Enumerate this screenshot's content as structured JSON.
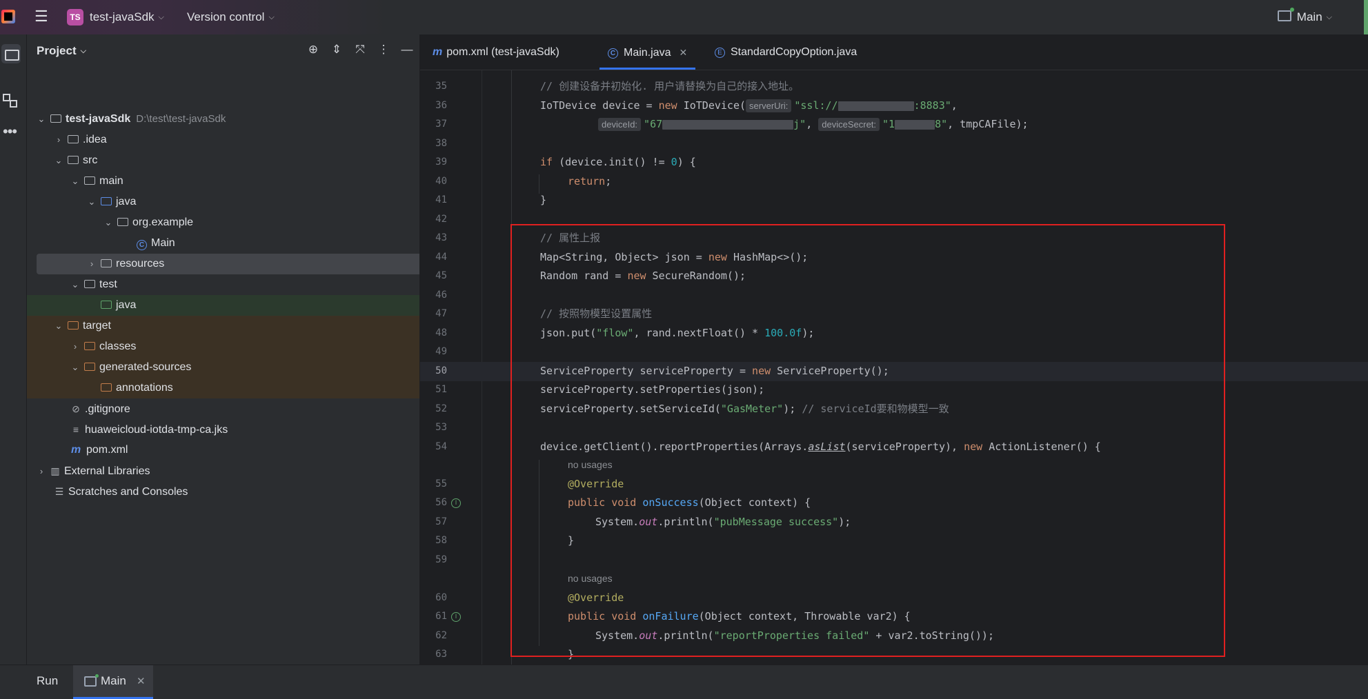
{
  "titlebar": {
    "project_chip": "TS",
    "project_name": "test-javaSdk",
    "vcs": "Version control",
    "run_config": "Main"
  },
  "project_panel": {
    "title": "Project",
    "tree": [
      {
        "label": "test-javaSdk",
        "hint": "D:\\test\\test-javaSdk"
      },
      {
        "label": ".idea"
      },
      {
        "label": "src"
      },
      {
        "label": "main"
      },
      {
        "label": "java"
      },
      {
        "label": "org.example"
      },
      {
        "label": "Main"
      },
      {
        "label": "resources"
      },
      {
        "label": "test"
      },
      {
        "label": "java"
      },
      {
        "label": "target"
      },
      {
        "label": "classes"
      },
      {
        "label": "generated-sources"
      },
      {
        "label": "annotations"
      },
      {
        "label": ".gitignore"
      },
      {
        "label": "huaweicloud-iotda-tmp-ca.jks"
      },
      {
        "label": "pom.xml"
      },
      {
        "label": "External Libraries"
      },
      {
        "label": "Scratches and Consoles"
      }
    ]
  },
  "editor": {
    "tabs": [
      {
        "label": "pom.xml (test-javaSdk)"
      },
      {
        "label": "Main.java"
      },
      {
        "label": "StandardCopyOption.java"
      }
    ],
    "line_numbers": [
      "35",
      "36",
      "37",
      "38",
      "39",
      "40",
      "41",
      "42",
      "43",
      "44",
      "45",
      "46",
      "47",
      "48",
      "49",
      "50",
      "51",
      "52",
      "53",
      "54",
      "55",
      "56",
      "57",
      "58",
      "59",
      "60",
      "61",
      "62",
      "63"
    ],
    "current_line": "50",
    "inlay": {
      "server_uri": "serverUri:",
      "device_id": "deviceId:",
      "device_secret": "deviceSecret:"
    },
    "usages": [
      "no usages",
      "no usages"
    ],
    "code": {
      "l35_comment": "// 创建设备并初始化. 用户请替换为自己的接入地址。",
      "l36_pre": "IoTDevice device = ",
      "l36_new": "new",
      "l36_ctor": " IoTDevice(",
      "l36_str_start": "\"ssl://",
      "l36_str_end": ":8883\"",
      "l36_comma": ",",
      "l37_str_a": "\"67",
      "l37_str_b": "j\"",
      "l37_comma": ", ",
      "l37_str_c": "\"1",
      "l37_str_d": "8\"",
      "l37_tail": ", tmpCAFile);",
      "l39_if": "if",
      "l39_mid": " (device.init() != ",
      "l39_num": "0",
      "l39_end": ") {",
      "l40_return": "return",
      "l40_semi": ";",
      "l41_brace": "}",
      "l43_comment": "// 属性上报",
      "l44_pre": "Map<String, Object> json = ",
      "l44_new": "new",
      "l44_post": " HashMap<>();",
      "l45_pre": "Random rand = ",
      "l45_new": "new",
      "l45_post": " SecureRandom();",
      "l47_comment": "// 按照物模型设置属性",
      "l48_pre": "json.put(",
      "l48_str": "\"flow\"",
      "l48_mid": ", rand.nextFloat() * ",
      "l48_num": "100.0f",
      "l48_end": ");",
      "l50_pre": "ServiceProperty serviceProperty = ",
      "l50_new": "new",
      "l50_post": " ServiceProperty();",
      "l51": "serviceProperty.setProperties(json);",
      "l52_pre": "serviceProperty.setServiceId(",
      "l52_str": "\"GasMeter\"",
      "l52_end": "); ",
      "l52_comment": "// serviceId要和物模型一致",
      "l54_pre": "device.getClient().reportProperties(Arrays.",
      "l54_aslist": "asList",
      "l54_mid": "(serviceProperty), ",
      "l54_new": "new",
      "l54_post": " ActionListener() {",
      "l55_ann": "@Override",
      "l56_kw": "public void ",
      "l56_fn": "onSuccess",
      "l56_post": "(Object context) {",
      "l57_pre": "System.",
      "l57_out": "out",
      "l57_mid": ".println(",
      "l57_str": "\"pubMessage success\"",
      "l57_end": ");",
      "l58_brace": "}",
      "l60_ann": "@Override",
      "l61_kw": "public void ",
      "l61_fn": "onFailure",
      "l61_post": "(Object context, Throwable var2) {",
      "l62_pre": "System.",
      "l62_out": "out",
      "l62_mid": ".println(",
      "l62_str": "\"reportProperties failed\"",
      "l62_end": " + var2.toString());",
      "l63_brace": "}"
    }
  },
  "bottombar": {
    "run_label": "Run",
    "run_tab_label": "Main"
  },
  "colors": {
    "accent": "#3574f0",
    "highlight_box": "#e02020",
    "keyword": "#cf8e6d",
    "string": "#6aab73",
    "number": "#2aacb8"
  },
  "icons": [
    "app-logo-icon",
    "hamburger-icon",
    "chevron-down-icon",
    "locate-icon",
    "expand-all-icon",
    "collapse-all-icon",
    "more-icon",
    "minimize-icon",
    "folder-icon",
    "class-icon",
    "maven-icon",
    "run-config-icon",
    "close-icon"
  ]
}
